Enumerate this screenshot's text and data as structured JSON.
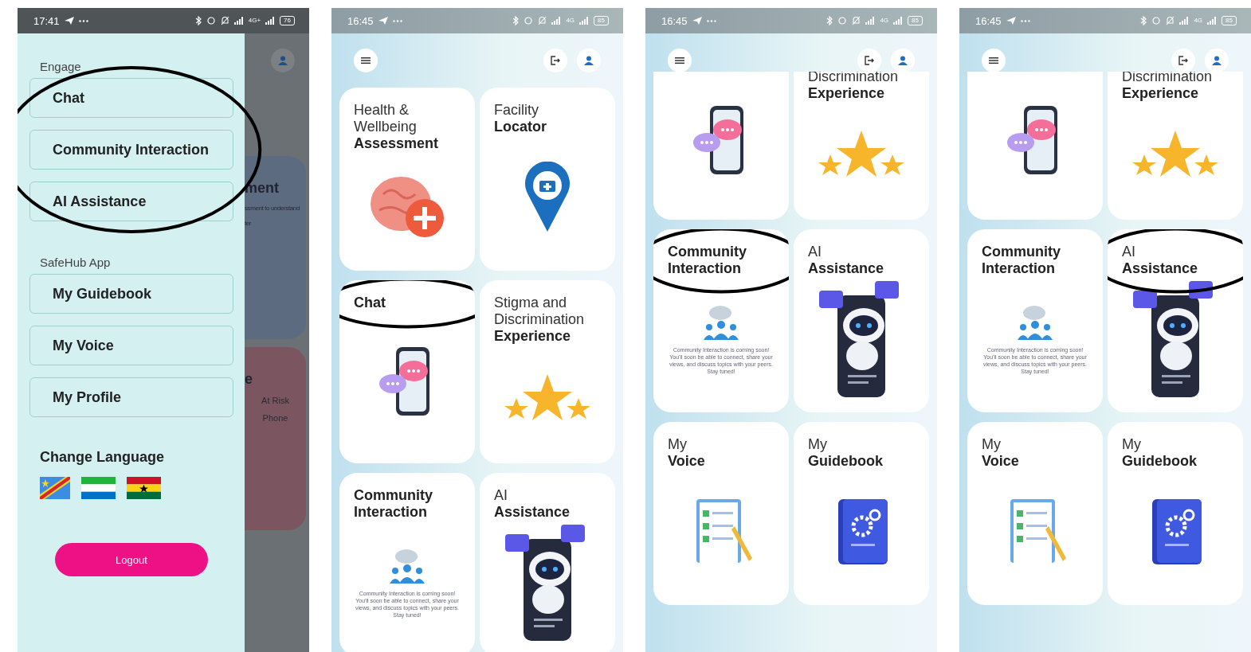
{
  "phones": [
    {
      "kind": "drawer",
      "status": {
        "time": "17:41",
        "network": "4G+",
        "battery": "76"
      },
      "sections": [
        {
          "title": "Engage",
          "circled": true,
          "items": [
            {
              "label": "Chat"
            },
            {
              "label": "Community Interaction"
            },
            {
              "label": "AI Assistance"
            }
          ]
        },
        {
          "title": "SafeHub App",
          "circled": false,
          "items": [
            {
              "label": "My Guidebook"
            },
            {
              "label": "My Voice"
            },
            {
              "label": "My Profile"
            }
          ]
        }
      ],
      "language": {
        "title": "Change Language",
        "flags": [
          {
            "kind": "drc"
          },
          {
            "kind": "sierra-leone"
          },
          {
            "kind": "ghana"
          }
        ]
      },
      "logout": "Logout",
      "behind": [
        {
          "kind": "blue",
          "heading": "ment",
          "texts": [
            "ssment to understand",
            "ter"
          ]
        },
        {
          "kind": "red",
          "heading": "e",
          "texts": [
            "At Risk",
            "Phone"
          ]
        }
      ]
    },
    {
      "kind": "home",
      "status": {
        "time": "16:45",
        "network": "4G",
        "battery": "85"
      },
      "cards": [
        {
          "light": "Health & Wellbeing",
          "bold": "Assessment",
          "kind": "brain",
          "circled": false,
          "cut": false
        },
        {
          "light": "Facility",
          "bold": "Locator",
          "kind": "pin",
          "circled": false,
          "cut": false
        },
        {
          "bold": "Chat",
          "kind": "phone-chat",
          "circled": true,
          "cut": false
        },
        {
          "light": "Stigma and Discrimination",
          "bold": "Experience",
          "kind": "stars",
          "circled": false,
          "cut": false
        },
        {
          "bold": "Community Interaction",
          "kind": "people",
          "circled": false,
          "cut": false,
          "message": "Community Interaction is coming soon! You'll soon be able to connect, share your views, and discuss topics with your peers. Stay tuned!"
        },
        {
          "light": "AI",
          "bold": "Assistance",
          "kind": "robot",
          "circled": false,
          "cut": false
        }
      ]
    },
    {
      "kind": "home",
      "status": {
        "time": "16:45",
        "network": "4G",
        "battery": "85"
      },
      "cards": [
        {
          "kind": "phone-chat",
          "circled": false,
          "cut": true
        },
        {
          "light": "Discrimination",
          "bold": "Experience",
          "kind": "stars",
          "circled": false,
          "cut": true
        },
        {
          "bold": "Community Interaction",
          "kind": "people",
          "circled": true,
          "cut": false,
          "message": "Community Interaction is coming soon! You'll soon be able to connect, share your views, and discuss topics with your peers. Stay tuned!"
        },
        {
          "light": "AI",
          "bold": "Assistance",
          "kind": "robot",
          "circled": false,
          "cut": false
        },
        {
          "light": "My",
          "bold": "Voice",
          "kind": "checklist",
          "circled": false,
          "cut": false
        },
        {
          "light": "My",
          "bold": "Guidebook",
          "kind": "book",
          "circled": false,
          "cut": false
        }
      ]
    },
    {
      "kind": "home",
      "status": {
        "time": "16:45",
        "network": "4G",
        "battery": "85"
      },
      "cards": [
        {
          "kind": "phone-chat",
          "circled": false,
          "cut": true
        },
        {
          "light": "Discrimination",
          "bold": "Experience",
          "kind": "stars",
          "circled": false,
          "cut": true
        },
        {
          "bold": "Community Interaction",
          "kind": "people",
          "circled": false,
          "cut": false,
          "message": "Community Interaction is coming soon! You'll soon be able to connect, share your views, and discuss topics with your peers. Stay tuned!"
        },
        {
          "light": "AI",
          "bold": "Assistance",
          "kind": "robot",
          "circled": true,
          "cut": false
        },
        {
          "light": "My",
          "bold": "Voice",
          "kind": "checklist",
          "circled": false,
          "cut": false
        },
        {
          "light": "My",
          "bold": "Guidebook",
          "kind": "book",
          "circled": false,
          "cut": false
        }
      ]
    }
  ]
}
